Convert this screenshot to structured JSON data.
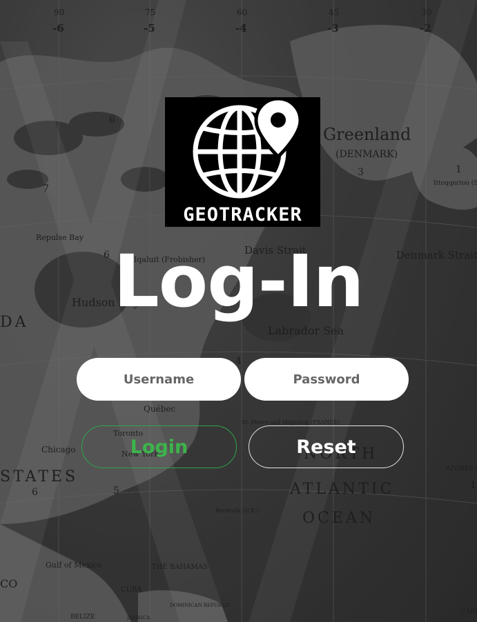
{
  "logo": {
    "wordmark": "GEOTRACKER"
  },
  "title": "Log-In",
  "form": {
    "username_placeholder": "Username",
    "password_placeholder": "Password",
    "login_label": "Login",
    "reset_label": "Reset"
  },
  "colors": {
    "login_accent": "#3cb44b",
    "input_bg": "#ffffff",
    "title": "#ffffff"
  },
  "map": {
    "top_scale": [
      "90",
      "75",
      "60",
      "45",
      "30"
    ],
    "zones": [
      "-6",
      "-5",
      "-4",
      "-3",
      "-2"
    ],
    "labels": {
      "greenland": "Greenland",
      "denmark": "(DENMARK)",
      "davis_strait": "Davis Strait",
      "hudson_bay": "Hudson Bay",
      "labrador_sea": "Labrador Sea",
      "denmark_strait": "Denmark Strait",
      "repulse_bay": "Repulse Bay",
      "iqaluit": "Iqaluit (Frobisher)",
      "quebec": "Québec",
      "toronto": "Toronto",
      "new_york": "New York",
      "chicago": "Chicago",
      "st_pierre": "St. Pierre and Miquelon (FRANCE)",
      "north": "NORTH",
      "atlantic": "ATLANTIC",
      "ocean": "OCEAN",
      "states": "STATES",
      "da": "DA",
      "azores": "AZORES (PORT.)",
      "bermuda": "Bermuda (U.K.)",
      "bahamas": "THE BAHAMAS",
      "cuba": "CUBA",
      "gulf_of_mexico": "Gulf of Mexico",
      "belize": "BELIZE",
      "jamaica": "JAMAICA",
      "dominican": "DOMINICAN REPUBLIC",
      "ittoqqortoormiit": "Ittoqqortoo (Scoresbysu",
      "cape": "CAPE",
      "co": "CO"
    },
    "zone_digits": [
      "6",
      "7",
      "6",
      "3",
      "5",
      "6",
      "4",
      "1",
      "1",
      "5"
    ]
  }
}
